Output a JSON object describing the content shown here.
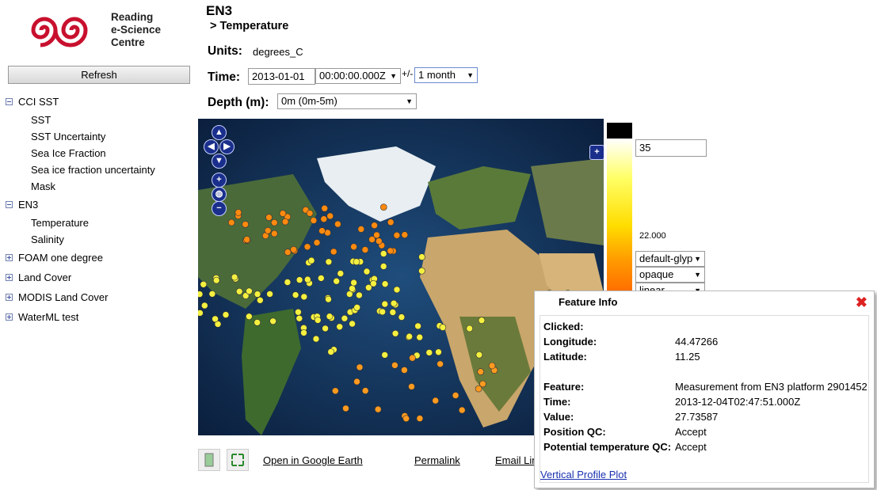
{
  "logo": {
    "line1": "Reading",
    "line2": "e-Science",
    "line3": "Centre"
  },
  "sidebar": {
    "refresh_label": "Refresh",
    "groups": [
      {
        "label": "CCI SST",
        "expanded": true,
        "items": [
          "SST",
          "SST Uncertainty",
          "Sea Ice Fraction",
          "Sea ice fraction uncertainty",
          "Mask"
        ]
      },
      {
        "label": "EN3",
        "expanded": true,
        "items": [
          "Temperature",
          "Salinity"
        ]
      },
      {
        "label": "FOAM one degree",
        "expanded": false
      },
      {
        "label": "Land Cover",
        "expanded": false
      },
      {
        "label": "MODIS Land Cover",
        "expanded": false
      },
      {
        "label": "WaterML test",
        "expanded": false
      }
    ]
  },
  "header": {
    "title": "EN3",
    "subtitle": "> Temperature",
    "units_label": "Units:",
    "units_value": "degrees_C",
    "time_label": "Time:",
    "time_date": "2013-01-01",
    "time_value": "00:00:00.000Z",
    "plus_minus": "+/-",
    "time_range": "1 month",
    "depth_label": "Depth (m):",
    "depth_value": "0m (0m-5m)"
  },
  "map_nav": {
    "up": "▲",
    "left": "◀",
    "right": "▶",
    "down": "▼",
    "zoom_in": "+",
    "globe": "globe-icon",
    "zoom_out": "−",
    "layer_switch": "+"
  },
  "colorscale": {
    "max": "35",
    "mid": "22.000",
    "palette": "default-glyph",
    "opacity": "opaque",
    "scaling": "linear"
  },
  "popup": {
    "title": "Feature Info",
    "rows": [
      {
        "k": "Clicked:",
        "v": ""
      },
      {
        "k": "Longitude:",
        "v": "44.47266"
      },
      {
        "k": "Latitude:",
        "v": "11.25"
      },
      {
        "k": "",
        "v": ""
      },
      {
        "k": "Feature:",
        "v": "Measurement from EN3 platform 2901452"
      },
      {
        "k": "Time:",
        "v": "2013-12-04T02:47:51.000Z"
      },
      {
        "k": "Value:",
        "v": "27.73587"
      },
      {
        "k": "Position QC:",
        "v": "Accept"
      },
      {
        "k": "Potential temperature QC:",
        "v": "Accept"
      }
    ],
    "link": "Vertical Profile Plot"
  },
  "footer": {
    "google_earth": "Open in Google Earth",
    "permalink": "Permalink",
    "email": "Email Lin"
  },
  "colors": {
    "popup_close": "#dd2222",
    "nav_button": "#1a2f8c",
    "link": "#1a30b0"
  }
}
